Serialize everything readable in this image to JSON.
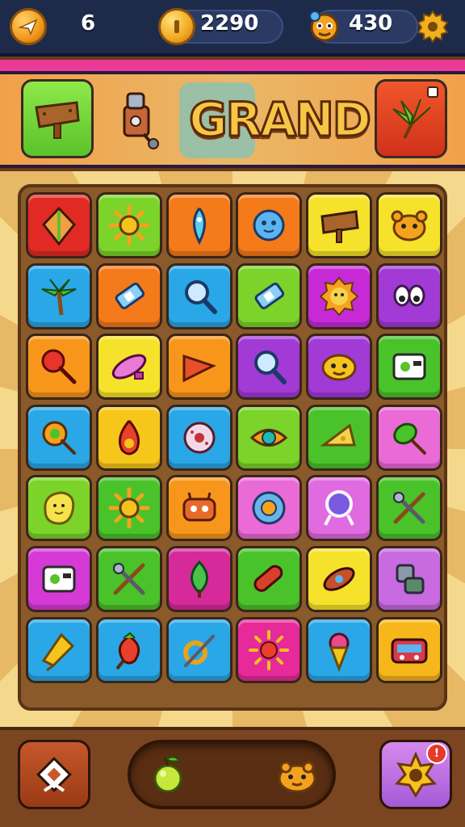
{
  "hud": {
    "lives": {
      "value": "6",
      "icon": "plane-badge-icon"
    },
    "coins": {
      "value": "2290",
      "icon": "coin-icon"
    },
    "score": {
      "value": "430",
      "icon": "critter-icon"
    },
    "settings_icon": "gear-icon"
  },
  "banner": {
    "title": "GRAND",
    "left_tile_icon": "wooden-sign-icon",
    "right_tile_icon": "palm-leaf-icon",
    "robot_icon": "robot-icon"
  },
  "board": {
    "rows": 7,
    "cols": 6,
    "tiles": [
      [
        {
          "color": "#e22a25",
          "icon": "leaf-kite"
        },
        {
          "color": "#7cd32a",
          "icon": "sun"
        },
        {
          "color": "#f47a1a",
          "icon": "drop-cone"
        },
        {
          "color": "#f47a1a",
          "icon": "blue-orb"
        },
        {
          "color": "#f6e22a",
          "icon": "wood-sign"
        },
        {
          "color": "#f6e22a",
          "icon": "bear-face"
        }
      ],
      [
        {
          "color": "#2aa7e6",
          "icon": "palm-tree"
        },
        {
          "color": "#f47a1a",
          "icon": "battery"
        },
        {
          "color": "#2aa7e6",
          "icon": "magnifier"
        },
        {
          "color": "#7cd32a",
          "icon": "battery"
        },
        {
          "color": "#c52ad6",
          "icon": "lion-face"
        },
        {
          "color": "#a23ad6",
          "icon": "eyes"
        }
      ],
      [
        {
          "color": "#f7961a",
          "icon": "red-rattle"
        },
        {
          "color": "#f6e22a",
          "icon": "surfboard"
        },
        {
          "color": "#f7961a",
          "icon": "red-shard"
        },
        {
          "color": "#a23ad6",
          "icon": "magnifier"
        },
        {
          "color": "#a23ad6",
          "icon": "blob-face"
        },
        {
          "color": "#4ac22a",
          "icon": "camera-box"
        }
      ],
      [
        {
          "color": "#2aa7e6",
          "icon": "lollipop"
        },
        {
          "color": "#f6c61a",
          "icon": "flame-drop"
        },
        {
          "color": "#2aa7e6",
          "icon": "donut"
        },
        {
          "color": "#7cd32a",
          "icon": "teal-eye"
        },
        {
          "color": "#4ac22a",
          "icon": "cheese-wedge"
        },
        {
          "color": "#ea6ad6",
          "icon": "green-pop"
        }
      ],
      [
        {
          "color": "#7cd32a",
          "icon": "yellow-blob"
        },
        {
          "color": "#4ac22a",
          "icon": "sun"
        },
        {
          "color": "#f7961a",
          "icon": "crab-bot"
        },
        {
          "color": "#ea6ad6",
          "icon": "blue-ring"
        },
        {
          "color": "#e06ae0",
          "icon": "mirror"
        },
        {
          "color": "#4ac22a",
          "icon": "crossed-tools"
        }
      ],
      [
        {
          "color": "#d63ad6",
          "icon": "camera-box"
        },
        {
          "color": "#4ac22a",
          "icon": "crossed-tools"
        },
        {
          "color": "#d62a9a",
          "icon": "green-leaf"
        },
        {
          "color": "#4ac22a",
          "icon": "red-capsule"
        },
        {
          "color": "#f6e22a",
          "icon": "rocket-roll"
        },
        {
          "color": "#c86ae0",
          "icon": "robot-parts"
        }
      ],
      [
        {
          "color": "#2aa7e6",
          "icon": "gold-star-ship"
        },
        {
          "color": "#2aa7e6",
          "icon": "red-berry"
        },
        {
          "color": "#2aa7e6",
          "icon": "wrench-ring"
        },
        {
          "color": "#e62a9a",
          "icon": "sun-orb"
        },
        {
          "color": "#2aa7e6",
          "icon": "ice-cream"
        },
        {
          "color": "#f7b61a",
          "icon": "radio"
        }
      ]
    ]
  },
  "bottom": {
    "left_button_icon": "diamond-flag-icon",
    "tray_items": [
      "green-fruit-icon",
      "orange-critter-icon"
    ],
    "right_button_icon": "gear-star-icon",
    "badge_icon": "notification-icon"
  },
  "colors": {
    "hud_bg": "#1d2a4a",
    "banner_pink": "#e83a96",
    "board_brown": "#8a5a2a"
  }
}
